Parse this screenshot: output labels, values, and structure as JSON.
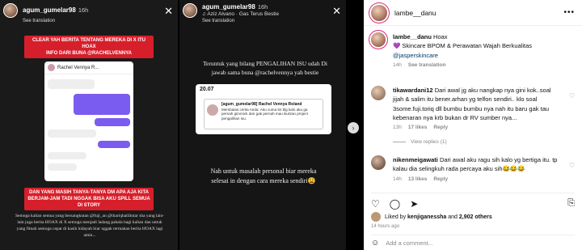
{
  "story1": {
    "username": "agum_gumelar98",
    "time": "16h",
    "see_translation": "See translation",
    "top_banner": "CLEAR YAH BERITA TENTANG MEREKA DI X ITU HOAX\nINFO DARI BUNA @RACHELVENNYA",
    "chat_name": "Rachel Vennya R...",
    "bottom_banner": "DAN YANG MASIH TANYA-TANYA DM APA AJA KITA BERJAM-JAM TADI NGGAK BISA AKU SPILL SEMUA DI STORY",
    "caption": "Semoga kalian semua yang bersangkutan @fuji_an @thariqhalilintar sha yang lain-lain juga berita HOAX di X semoga menjadi ladang pahala bagi kalian dan untuk yang fitnah semoga cepat di kasih hidayah biar nggak termakan berita HOAX lagi amin..."
  },
  "story2": {
    "username": "agum_gumelar98",
    "time": "16h",
    "music": "Aziz Alvano · Gas Terus Bestie",
    "see_translation": "See translation",
    "text_top": "Teruntuk yang bilang PENGALIHAN ISU udah Di jawab sama buna @rachelvennya yah bestie",
    "card_time": "20.07",
    "card_title": "[agum_gumelar98] Rachel Vennya Roland",
    "card_text": "Membalas cerita Anda: Aku cuma bs blg kalo aku ga pernah gimmick dan gak pernah mau ikut2an project pengalihan isu.",
    "text_bottom": "Nah untuk masalah personal biar mereka selesai in dengan cara mereka sendiri😩"
  },
  "sidebar": {
    "account": "lambe__danu",
    "more": "•••",
    "caption_user": "lambe__danu",
    "caption_title": "Hoax",
    "caption_lines": [
      "💜 Skincare BPOM & Perawatan Wajah Berkualitas",
      "@jasperskincare"
    ],
    "caption_time": "14h",
    "caption_translate": "See translation",
    "comments": [
      {
        "user": "tikawardani12",
        "text": "Dari awal jg aku nangkap nya gini kok..soal jijah & salim itu bener.arhan yg telfon sendiri.. klo soal 3some.fuji.toriq dll bumbu bumbu nya nah itu baru gak tau kebenaran nya krb bukan dr RV sumber nya...",
        "time": "13h",
        "likes": "17 likes",
        "reply": "Reply",
        "view_replies": "View replies (1)"
      },
      {
        "user": "nikenmeigawati",
        "text": "Dari awal aku ragu sih kalo yg bertiga itu. tp kalau dia selingkuh rada percaya aku sih😂😂😂",
        "time": "14h",
        "likes": "13 likes",
        "reply": "Reply"
      }
    ],
    "liked_by": "Liked by",
    "liked_user": "kenjiganessha",
    "liked_and": "and",
    "liked_others": "2,902 others",
    "post_time": "14 hours ago",
    "add_comment": "Add a comment..."
  }
}
